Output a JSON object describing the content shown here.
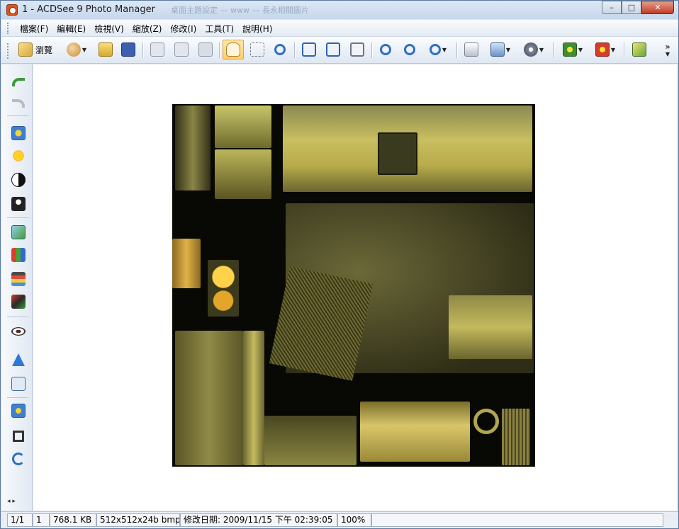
{
  "window": {
    "title": "1 - ACDSee 9 Photo Manager",
    "ghost_title": "桌面主題設定 — www — 長永相關圖片",
    "caption": {
      "minimize": "–",
      "maximize": "□",
      "close": "✕"
    }
  },
  "menu": [
    "檔案(F)",
    "編輯(E)",
    "檢視(V)",
    "縮放(Z)",
    "修改(I)",
    "工具(T)",
    "說明(H)"
  ],
  "toolbar": {
    "browse_label": "瀏覽",
    "buttons": [
      "browse-icon",
      "editor-icon",
      "open-folder-icon",
      "save-icon",
      "previous-image-icon",
      "next-image-icon",
      "image-set-icon",
      "hand-pan-icon",
      "select-icon",
      "zoom-tool-icon",
      "rotate-left-icon",
      "rotate-right-icon",
      "auto-rotate-icon",
      "zoom-in-icon",
      "zoom-out-icon",
      "zoom-level-icon",
      "print-icon",
      "acquire-icon",
      "slideshow-icon",
      "wallpaper-center-icon",
      "wallpaper-tile-icon",
      "export-icon"
    ],
    "overflow": "»"
  },
  "sidebar": {
    "buttons": [
      "undo-icon",
      "redo-icon",
      "auto-exposure-icon",
      "lighting-icon",
      "contrast-icon",
      "shadows-icon",
      "levels-icon",
      "color-balance-icon",
      "curves-icon",
      "color-icon",
      "red-eye-icon",
      "sharpen-icon",
      "noise-icon",
      "effects-icon",
      "crop-icon",
      "rotate-flip-icon"
    ]
  },
  "status": {
    "index": "1/1",
    "selected": "1",
    "size": "768.1 KB",
    "dimensions": "512x512x24b bmp",
    "modified": "修改日期: 2009/11/15 下午 02:39:05",
    "zoom": "100%"
  },
  "colors": {
    "accent": "#ffd06a",
    "texture_gold": "#c8b85a",
    "texture_dark": "#3a3a22"
  }
}
